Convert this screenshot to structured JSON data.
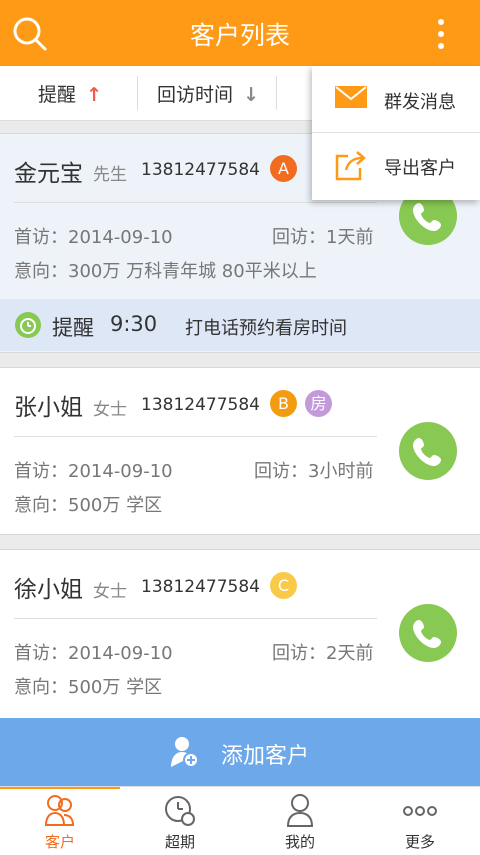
{
  "header": {
    "title": "客户列表",
    "search_icon": "search-icon",
    "more_icon": "more-vertical-icon"
  },
  "filters": [
    {
      "label": "提醒",
      "arrow": "↑",
      "arrow_color": "#f05a4a"
    },
    {
      "label": "回访时间",
      "arrow": "↓",
      "arrow_color": "#888888"
    }
  ],
  "customers": [
    {
      "name": "金元宝",
      "title": "先生",
      "phone": "13812477584",
      "grade": "A",
      "grade_color": "#f26c1f",
      "first_visit": "首访：2014-09-10",
      "last_visit": "回访：1天前",
      "intent": "意向：300万   万科青年城   80平米以上"
    },
    {
      "name": "张小姐",
      "title": "女士",
      "phone": "13812477584",
      "grade": "B",
      "grade_color": "#f39c12",
      "tag": "房",
      "tag_color": "#c39ad9",
      "first_visit": "首访：2014-09-10",
      "last_visit": "回访：3小时前",
      "intent": "意向：500万   学区"
    },
    {
      "name": "徐小姐",
      "title": "女士",
      "phone": "13812477584",
      "grade": "C",
      "grade_color": "#f9c94a",
      "first_visit": "首访：2014-09-10",
      "last_visit": "回访：2天前",
      "intent": "意向：500万   学区"
    }
  ],
  "reminder": {
    "label": "提醒",
    "time": "9:30",
    "text": "打电话预约看房时间"
  },
  "add_button": {
    "label": "添加客户"
  },
  "popup_menu": [
    {
      "label": "群发消息",
      "icon": "mail-icon"
    },
    {
      "label": "导出客户",
      "icon": "export-icon"
    }
  ],
  "tabs": [
    {
      "label": "客户",
      "icon": "customers-icon",
      "active": true
    },
    {
      "label": "超期",
      "icon": "overdue-clock-icon"
    },
    {
      "label": "我的",
      "icon": "profile-icon"
    },
    {
      "label": "更多",
      "icon": "more-dots-icon"
    }
  ],
  "colors": {
    "brand": "#ff9a17",
    "call": "#88c953",
    "add_bar": "#6da8ea",
    "reminder_bg": "#dde7f5"
  }
}
